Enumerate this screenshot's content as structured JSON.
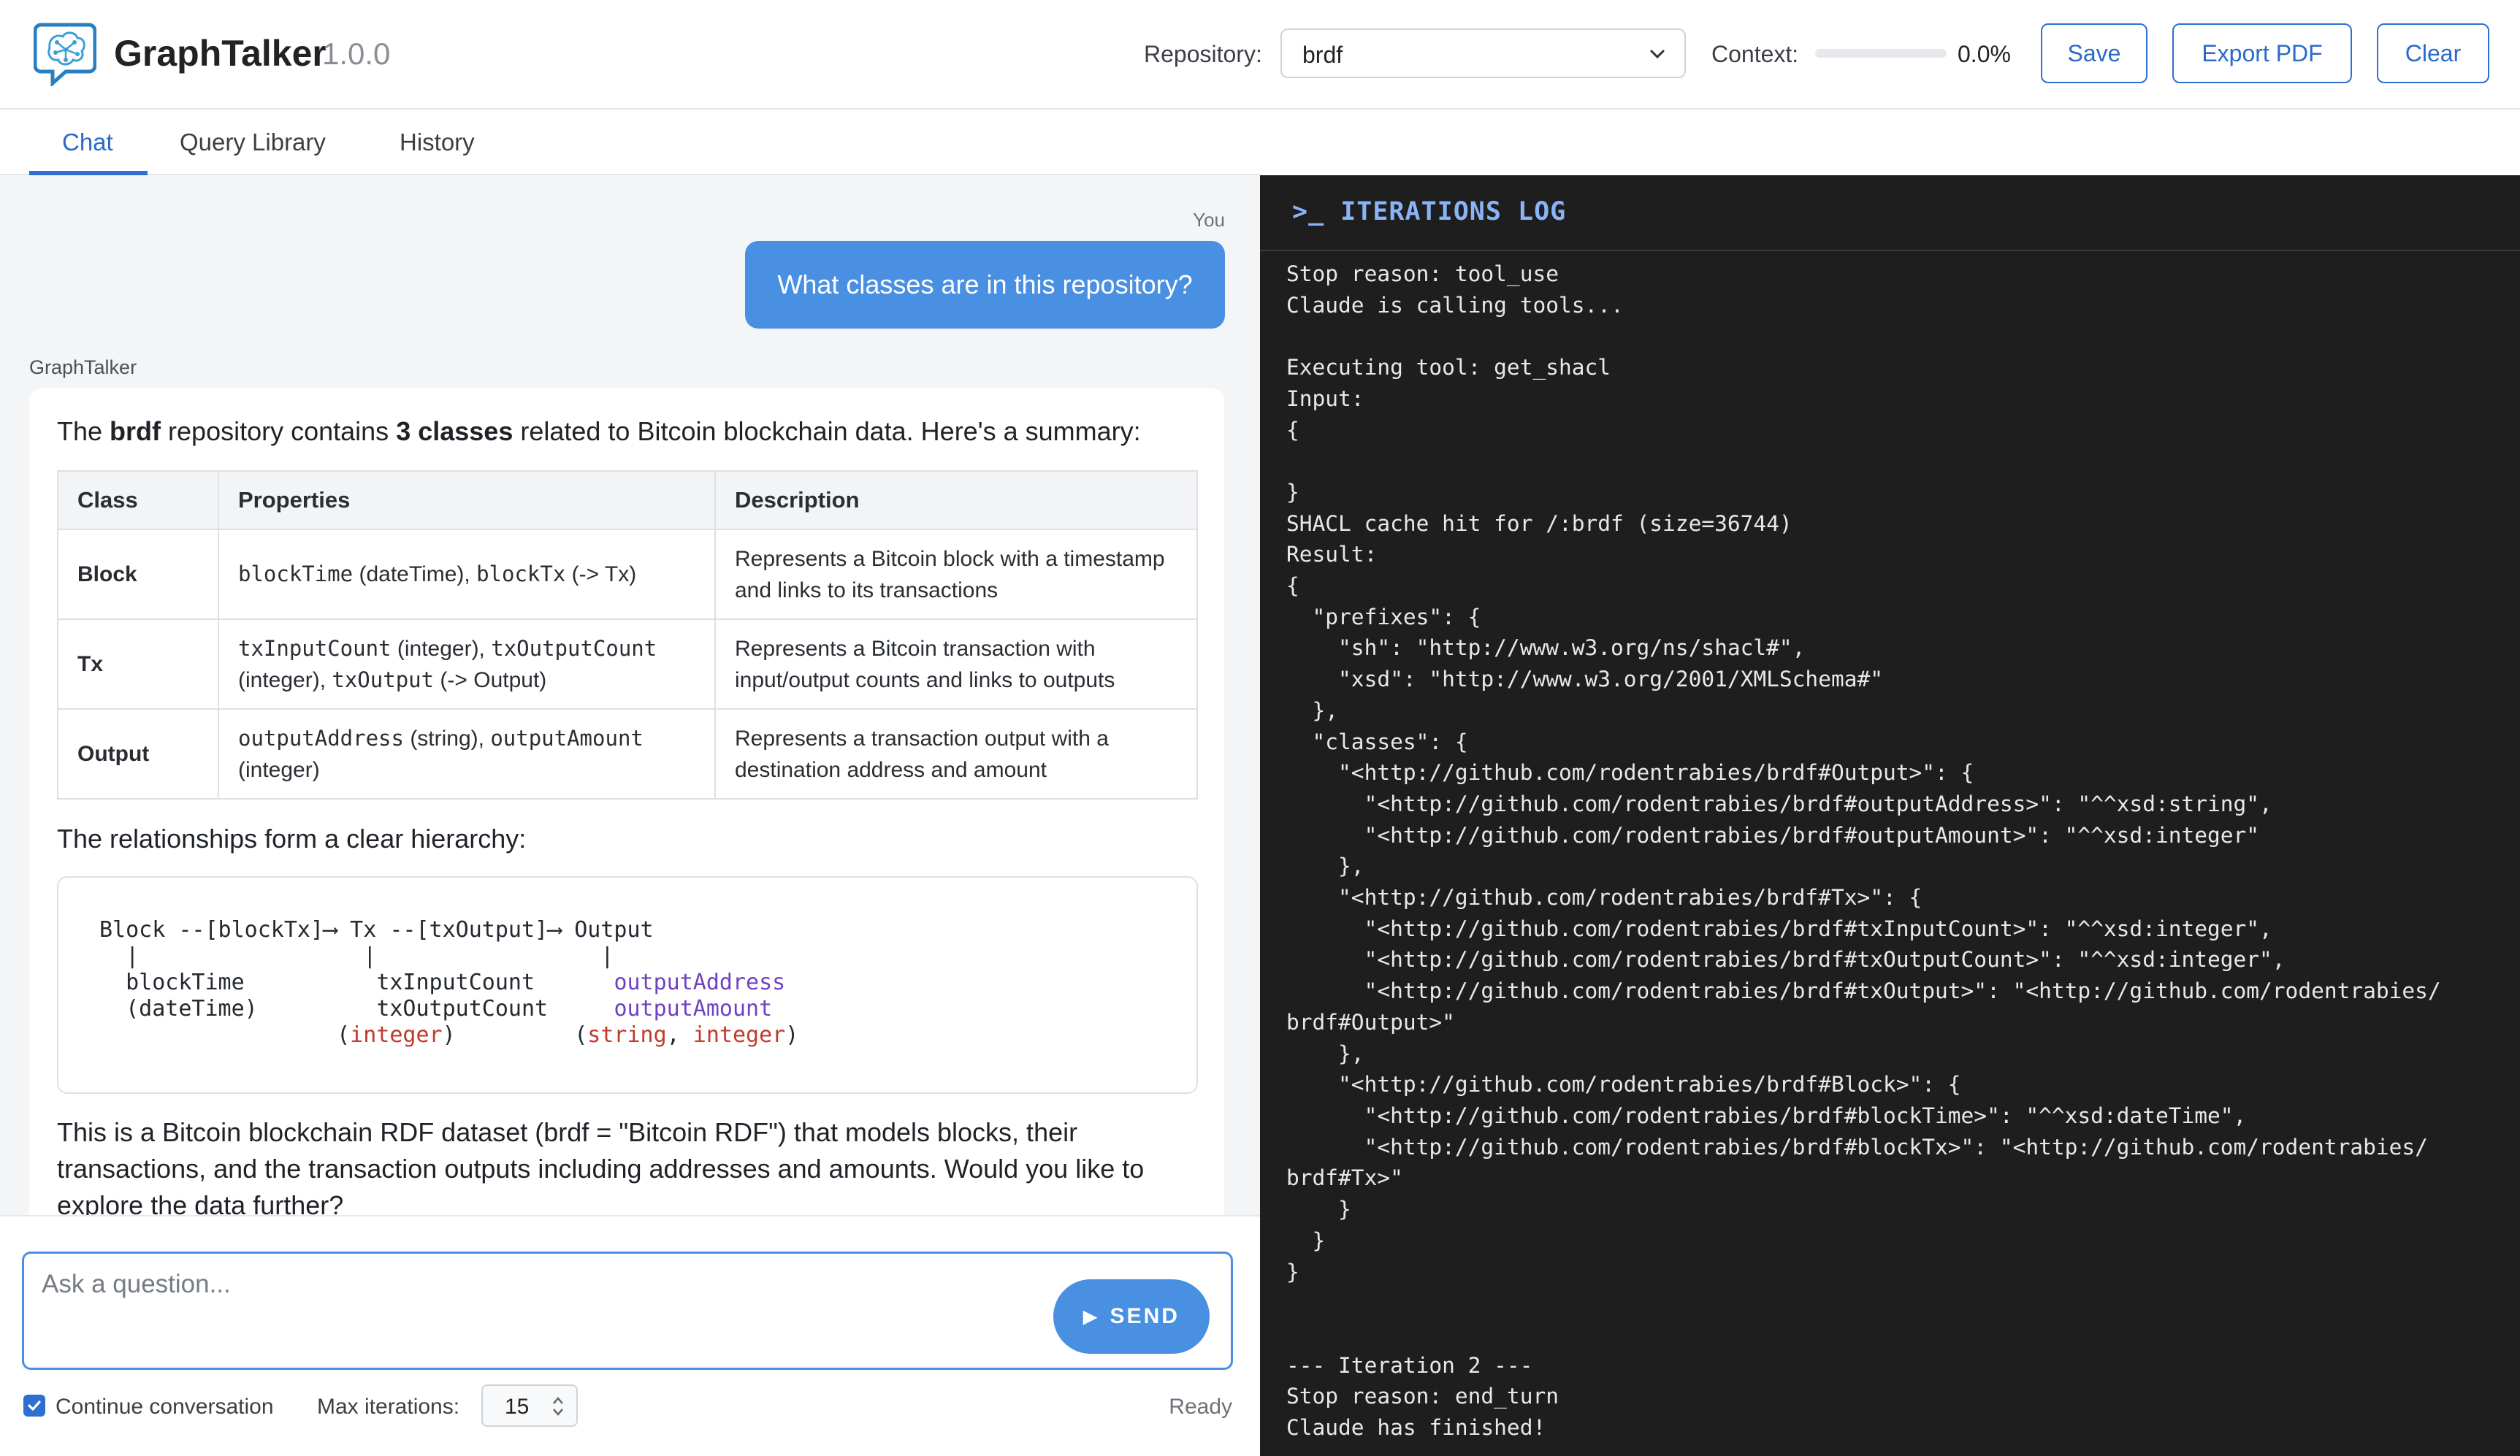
{
  "header": {
    "app_name": "GraphTalker",
    "version": "1.0.0",
    "repository_label": "Repository:",
    "repository_value": "brdf",
    "context_label": "Context:",
    "context_value": "0.0%",
    "context_fraction": 0.0,
    "save_label": "Save",
    "export_label": "Export PDF",
    "clear_label": "Clear",
    "accent_color": "#2e6fd1"
  },
  "tabs": [
    {
      "label": "Chat",
      "active": true
    },
    {
      "label": "Query Library",
      "active": false
    },
    {
      "label": "History",
      "active": false
    }
  ],
  "chat": {
    "user_label": "You",
    "user_message": "What classes are in this repository?",
    "assistant_label": "GraphTalker",
    "intro": {
      "p1": "The ",
      "repo": "brdf",
      "p2": " repository contains ",
      "count": "3 classes",
      "p3": " related to Bitcoin blockchain data. Here's a summary:"
    },
    "table": {
      "headers": [
        "Class",
        "Properties",
        "Description"
      ],
      "rows": [
        {
          "name": "Block",
          "props": [
            {
              "code": "blockTime",
              "text": " (dateTime), "
            },
            {
              "code": "blockTx",
              "text": " (-> Tx)"
            }
          ],
          "desc": "Represents a Bitcoin block with a timestamp and links to its transactions"
        },
        {
          "name": "Tx",
          "props": [
            {
              "code": "txInputCount",
              "text": " (integer), "
            },
            {
              "code": "txOutputCount",
              "text": " (integer), "
            },
            {
              "code": "txOutput",
              "text": " (-> Output)"
            }
          ],
          "desc": "Represents a Bitcoin transaction with input/output counts and links to outputs"
        },
        {
          "name": "Output",
          "props": [
            {
              "code": "outputAddress",
              "text": " (string), "
            },
            {
              "code": "outputAmount",
              "text": " (integer)"
            }
          ],
          "desc": "Represents a transaction output with a destination address and amount"
        }
      ]
    },
    "relationship_text": "The relationships form a clear hierarchy:",
    "diagram": {
      "line1": "Block --[blockTx]⟶ Tx --[txOutput]⟶ Output",
      "line2": "  |                 |                 |",
      "block_c1": "  blockTime",
      "block_c2": "  (dateTime)",
      "tx_c1": "txInputCount",
      "tx_c2": "txOutputCount",
      "tx_c3_open": "(",
      "tx_c3_type": "integer",
      "tx_c3_close": ")",
      "out_c1": "outputAddress",
      "out_c2": "outputAmount",
      "out_c3_open": "(",
      "out_c3_t1": "string",
      "out_c3_sep": ", ",
      "out_c3_t2": "integer",
      "out_c3_close": ")"
    },
    "summary": "This is a Bitcoin blockchain RDF dataset (brdf = \"Bitcoin RDF\") that models blocks, their transactions, and the transaction outputs including addresses and amounts. Would you like to explore the data further?"
  },
  "input": {
    "placeholder": "Ask a question...",
    "send_label": "SEND",
    "continue_label": "Continue conversation",
    "continue_checked": true,
    "max_iterations_label": "Max iterations:",
    "max_iterations_value": "15",
    "status": "Ready"
  },
  "log": {
    "title": ">_ ITERATIONS LOG",
    "lines": [
      "Stop reason: tool_use",
      "Claude is calling tools...",
      "",
      "Executing tool: get_shacl",
      "Input:",
      "{",
      "",
      "}",
      "SHACL cache hit for /:brdf (size=36744)",
      "Result:",
      "{",
      "  \"prefixes\": {",
      "    \"sh\": \"http://www.w3.org/ns/shacl#\",",
      "    \"xsd\": \"http://www.w3.org/2001/XMLSchema#\"",
      "  },",
      "  \"classes\": {",
      "    \"<http://github.com/rodentrabies/brdf#Output>\": {",
      "      \"<http://github.com/rodentrabies/brdf#outputAddress>\": \"^^xsd:string\",",
      "      \"<http://github.com/rodentrabies/brdf#outputAmount>\": \"^^xsd:integer\"",
      "    },",
      "    \"<http://github.com/rodentrabies/brdf#Tx>\": {",
      "      \"<http://github.com/rodentrabies/brdf#txInputCount>\": \"^^xsd:integer\",",
      "      \"<http://github.com/rodentrabies/brdf#txOutputCount>\": \"^^xsd:integer\",",
      "      \"<http://github.com/rodentrabies/brdf#txOutput>\": \"<http://github.com/rodentrabies/",
      "brdf#Output>\"",
      "    },",
      "    \"<http://github.com/rodentrabies/brdf#Block>\": {",
      "      \"<http://github.com/rodentrabies/brdf#blockTime>\": \"^^xsd:dateTime\",",
      "      \"<http://github.com/rodentrabies/brdf#blockTx>\": \"<http://github.com/rodentrabies/",
      "brdf#Tx>\"",
      "    }",
      "  }",
      "}",
      "",
      "",
      "--- Iteration 2 ---",
      "Stop reason: end_turn",
      "Claude has finished!"
    ]
  },
  "icons": {
    "logo": "brain-chat-logo-icon",
    "select": "chevron-down-icon",
    "send": "play-arrow-icon",
    "checkbox": "checkmark-icon",
    "stepper": "stepper-arrows-icon"
  }
}
